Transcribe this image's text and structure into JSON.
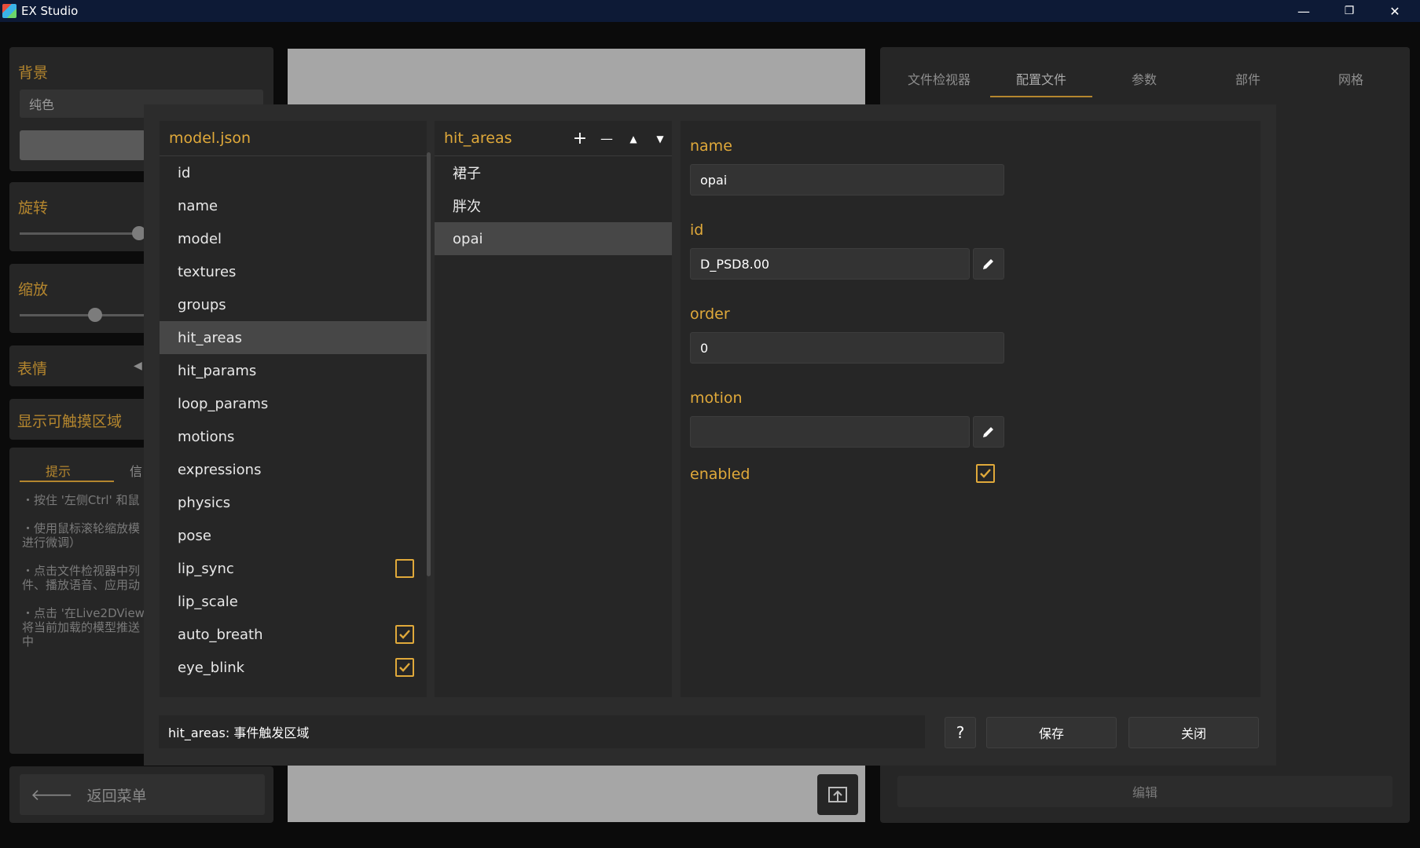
{
  "window": {
    "title": "EX Studio",
    "minimize": "—",
    "maximize": "❐",
    "close": "✕"
  },
  "left_panel": {
    "background_label": "背景",
    "background_select": "纯色",
    "rotate_label": "旋转",
    "scale_label": "缩放",
    "expression_label": "表情",
    "show_hit_label": "显示可触摸区域",
    "tabs": [
      "提示",
      "信"
    ],
    "tips": [
      "・按住 '左侧Ctrl' 和鼠",
      "・使用鼠标滚轮缩放模\n进行微调）",
      "・点击文件检视器中列\n件、播放语音、应用动",
      "・点击 '在Live2DView\n将当前加载的模型推送\n中"
    ],
    "back_menu": "返回菜单"
  },
  "right_panel": {
    "tabs": [
      "文件检视器",
      "配置文件",
      "参数",
      "部件",
      "网格"
    ],
    "active_tab": 1,
    "edit_button": "编辑"
  },
  "dialog": {
    "file_column": {
      "header": "model.json",
      "items": [
        {
          "label": "id",
          "checkbox": null
        },
        {
          "label": "name",
          "checkbox": null
        },
        {
          "label": "model",
          "checkbox": null
        },
        {
          "label": "textures",
          "checkbox": null
        },
        {
          "label": "groups",
          "checkbox": null
        },
        {
          "label": "hit_areas",
          "checkbox": null,
          "selected": true
        },
        {
          "label": "hit_params",
          "checkbox": null
        },
        {
          "label": "loop_params",
          "checkbox": null
        },
        {
          "label": "motions",
          "checkbox": null
        },
        {
          "label": "expressions",
          "checkbox": null
        },
        {
          "label": "physics",
          "checkbox": null
        },
        {
          "label": "pose",
          "checkbox": null
        },
        {
          "label": "lip_sync",
          "checkbox": false
        },
        {
          "label": "lip_scale",
          "checkbox": null
        },
        {
          "label": "auto_breath",
          "checkbox": true
        },
        {
          "label": "eye_blink",
          "checkbox": true
        }
      ]
    },
    "area_column": {
      "header": "hit_areas",
      "tools": {
        "add": "+",
        "remove": "—",
        "up": "▲",
        "down": "▼"
      },
      "items": [
        {
          "label": "裙子"
        },
        {
          "label": "胖次"
        },
        {
          "label": "opai",
          "selected": true
        }
      ]
    },
    "props": {
      "name_label": "name",
      "name_value": "opai",
      "id_label": "id",
      "id_value": "D_PSD8.00",
      "order_label": "order",
      "order_value": "0",
      "motion_label": "motion",
      "motion_value": "",
      "enabled_label": "enabled",
      "enabled": true
    },
    "status_text": "hit_areas: 事件触发区域",
    "help_button": "?",
    "save_button": "保存",
    "close_button": "关闭"
  },
  "colors": {
    "accent": "#e0a93a",
    "dialog_bg": "#2c2c2c",
    "panel_bg": "#262626",
    "selected_bg": "#474747",
    "titlebar": "#0d1a36"
  }
}
